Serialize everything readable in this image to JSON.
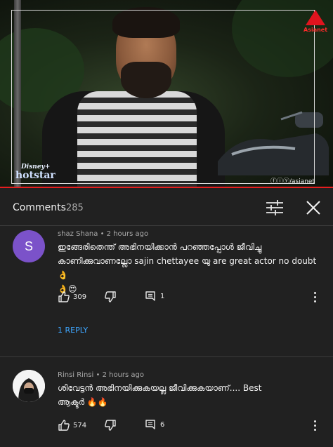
{
  "video": {
    "channel_logo_text": "Asianet",
    "streaming_brand": "Disney+",
    "streaming_brand_sub": "hotstar",
    "watermark": "ⓕⓘⓨ/asianet",
    "progress_fraction": 1.0
  },
  "comments_panel": {
    "title": "Comments",
    "count": "285",
    "filter_icon": "sliders-icon",
    "close_icon": "close-icon"
  },
  "comments": [
    {
      "author": "shaz Shana",
      "time": "2 hours ago",
      "avatar_letter": "S",
      "avatar_color": "#7b52c9",
      "text_line1": "ഇങ്ങേരിതെന്ത് അഭിനയിക്കാൻ പറഞ്ഞപ്പോൾ ജീവിച്ചു",
      "text_line2": "കാണിക്കുവാണല്ലോ sajin chettayee യു are great actor no doubt👌",
      "text_line3": "👌😍",
      "likes": "309",
      "replies": "1",
      "reply_link": "1 REPLY"
    },
    {
      "author": "Rinsi Rinsi",
      "time": "2 hours ago",
      "text_line1": "ശിവേട്ടൻ അഭിനയിക്കുകയല്ല ജീവിക്കുകയാണ്.... Best",
      "text_line2": "ആക്ടർ 🔥🔥",
      "likes": "574",
      "replies": "6"
    }
  ],
  "colors": {
    "background": "#212121",
    "link_blue": "#3ea6ff",
    "progress_red": "#e51e1e"
  }
}
